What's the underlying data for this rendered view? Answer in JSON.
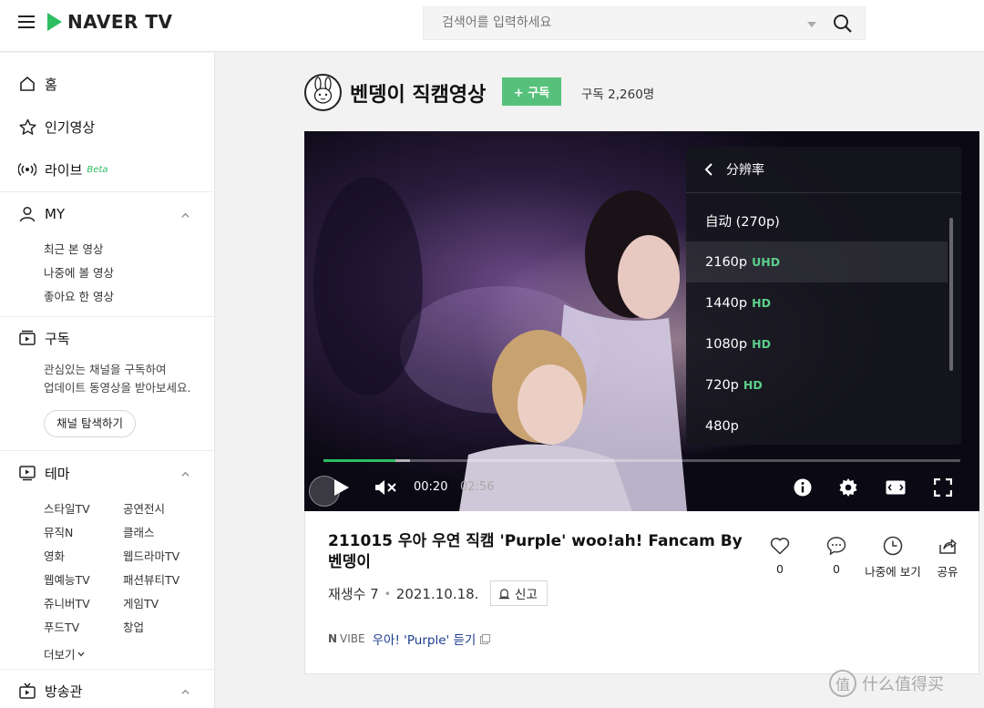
{
  "header": {
    "logo_text": "NAVER TV",
    "search_placeholder": "검색어를 입력하세요"
  },
  "sidebar": {
    "home": "홈",
    "popular": "인기영상",
    "live": "라이브",
    "live_badge": "Beta",
    "my": {
      "label": "MY",
      "items": [
        "최근 본 영상",
        "나중에 볼 영상",
        "좋아요 한 영상"
      ]
    },
    "subscribe": {
      "label": "구독",
      "desc_line1": "관심있는 채널을 구독하여",
      "desc_line2": "업데이트 동영상을 받아보세요.",
      "explore_label": "채널 탐색하기"
    },
    "theme": {
      "label": "테마",
      "col1": [
        "스타일TV",
        "뮤직N",
        "영화",
        "웹예능TV",
        "쥬니버TV",
        "푸드TV"
      ],
      "col2": [
        "공연전시",
        "클래스",
        "웹드라마TV",
        "패션뷰티TV",
        "게임TV",
        "창업"
      ],
      "more_label": "더보기"
    },
    "broadcast": "방송관"
  },
  "channel": {
    "name": "벤뎅이 직캠영상",
    "subscribe_label": "+ 구독",
    "subscriber_count": "구독 2,260명"
  },
  "player": {
    "current_time": "00:20",
    "duration": "02:56",
    "progress_fraction": 0.113,
    "resolution_menu": {
      "title": "分辨率",
      "options": [
        {
          "label": "自动 (270p)",
          "tag": ""
        },
        {
          "label": "2160p",
          "tag": "UHD"
        },
        {
          "label": "1440p",
          "tag": "HD"
        },
        {
          "label": "1080p",
          "tag": "HD"
        },
        {
          "label": "720p",
          "tag": "HD"
        },
        {
          "label": "480p",
          "tag": ""
        }
      ]
    }
  },
  "video": {
    "title": "211015 우아 우연 직캠 'Purple' woo!ah! Fancam By 벤뎅이",
    "views": "재생수 7",
    "date": "2021.10.18.",
    "report_label": "신고",
    "vibe_n": "N",
    "vibe_tag": "VIBE",
    "vibe_song": "우아! 'Purple' 듣기",
    "likes": "0",
    "comments": "0",
    "watch_later_label": "나중에 보기",
    "share_label": "공유"
  },
  "watermark": {
    "icon_char": "值",
    "text": "什么值得买"
  },
  "colors": {
    "naver_green": "#2dbe60",
    "subscribe_green": "#57c17b",
    "tag_green": "#5bd08a"
  }
}
